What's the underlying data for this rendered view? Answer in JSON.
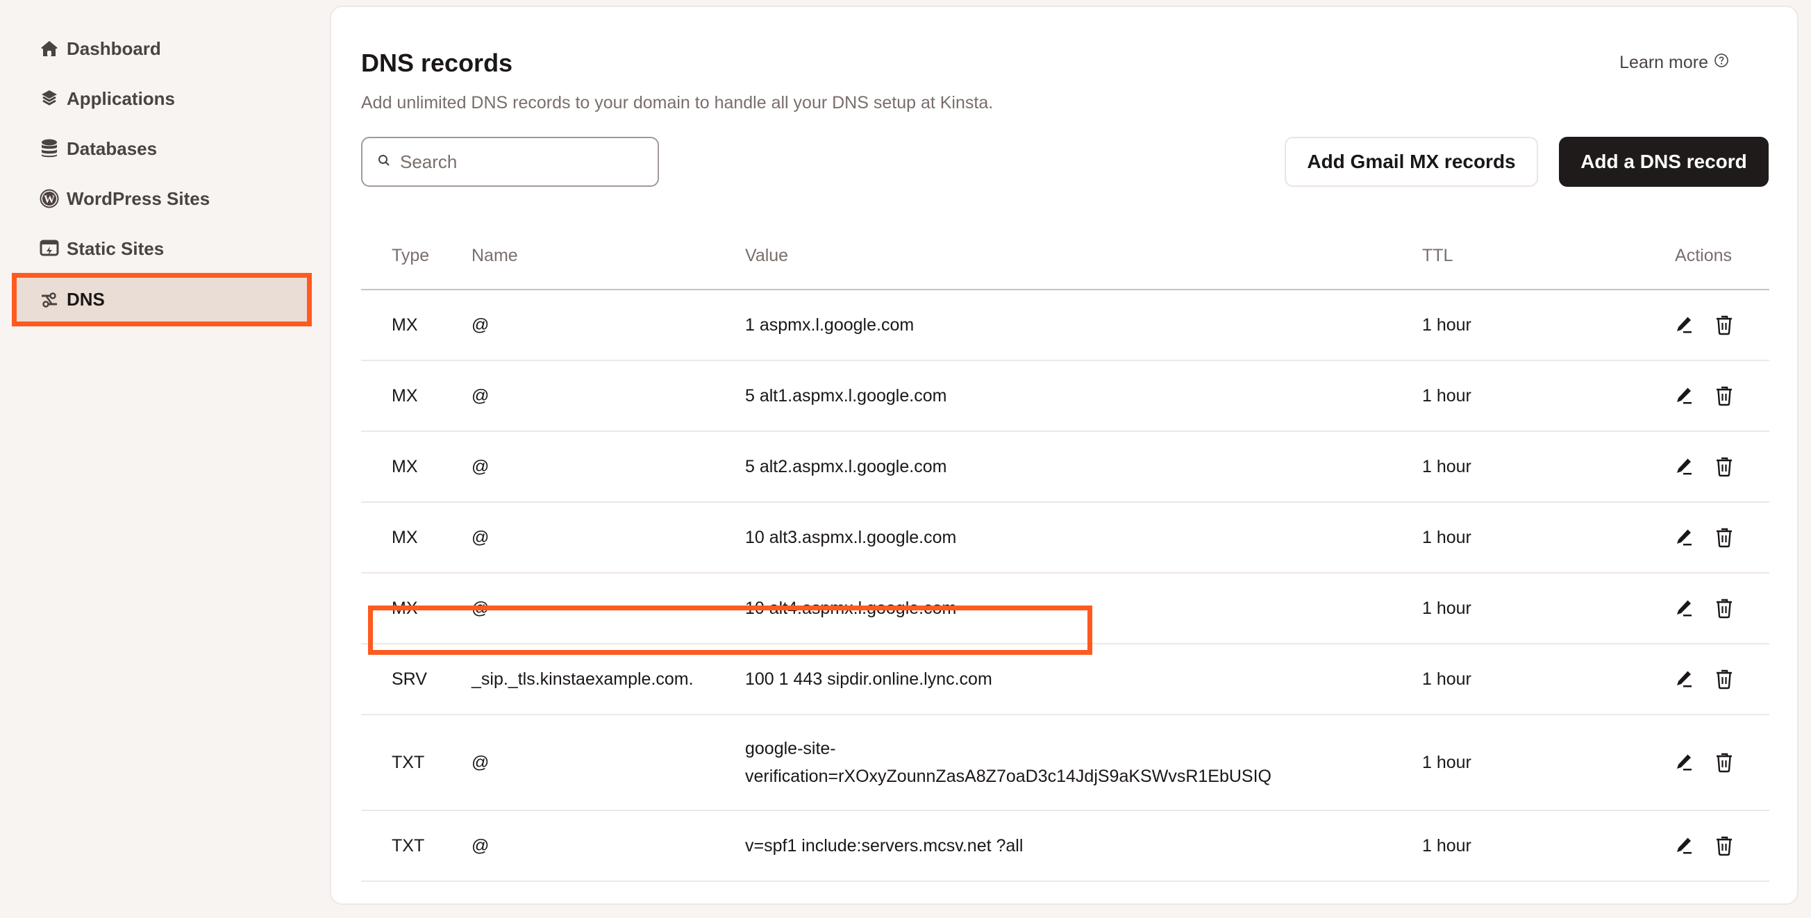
{
  "sidebar": {
    "items": [
      {
        "label": "Dashboard",
        "icon": "home-icon",
        "active": false
      },
      {
        "label": "Applications",
        "icon": "layers-icon",
        "active": false
      },
      {
        "label": "Databases",
        "icon": "database-icon",
        "active": false
      },
      {
        "label": "WordPress Sites",
        "icon": "wordpress-icon",
        "active": false
      },
      {
        "label": "Static Sites",
        "icon": "static-site-icon",
        "active": false
      },
      {
        "label": "DNS",
        "icon": "dns-icon",
        "active": true
      }
    ]
  },
  "main": {
    "title": "DNS records",
    "subtitle": "Add unlimited DNS records to your domain to handle all your DNS setup at Kinsta.",
    "learn_more": "Learn more",
    "search": {
      "placeholder": "Search",
      "value": ""
    },
    "buttons": {
      "add_gmail_mx": "Add Gmail MX records",
      "add_dns_record": "Add a DNS record"
    },
    "table": {
      "columns": [
        "Type",
        "Name",
        "Value",
        "TTL",
        "Actions"
      ],
      "rows": [
        {
          "type": "MX",
          "name": "@",
          "value": "1 aspmx.l.google.com",
          "ttl": "1 hour"
        },
        {
          "type": "MX",
          "name": "@",
          "value": "5 alt1.aspmx.l.google.com",
          "ttl": "1 hour"
        },
        {
          "type": "MX",
          "name": "@",
          "value": "5 alt2.aspmx.l.google.com",
          "ttl": "1 hour"
        },
        {
          "type": "MX",
          "name": "@",
          "value": "10 alt3.aspmx.l.google.com",
          "ttl": "1 hour"
        },
        {
          "type": "MX",
          "name": "@",
          "value": "10 alt4.aspmx.l.google.com",
          "ttl": "1 hour"
        },
        {
          "type": "SRV",
          "name": "_sip._tls.kinstaexample.com.",
          "value": "100 1 443 sipdir.online.lync.com",
          "ttl": "1 hour"
        },
        {
          "type": "TXT",
          "name": "@",
          "value_line1": "google-site-",
          "value_line2": "verification=rXOxyZounnZasA8Z7oaD3c14JdjS9aKSWvsR1EbUSIQ",
          "ttl": "1 hour"
        },
        {
          "type": "TXT",
          "name": "@",
          "value": "v=spf1 include:servers.mcsv.net ?all",
          "ttl": "1 hour"
        }
      ]
    }
  },
  "colors": {
    "highlight": "#ff5a1f",
    "primary_button": "#1f1b1b",
    "active_nav_bg": "#e9ddd5",
    "page_bg": "#f8f4f2"
  }
}
